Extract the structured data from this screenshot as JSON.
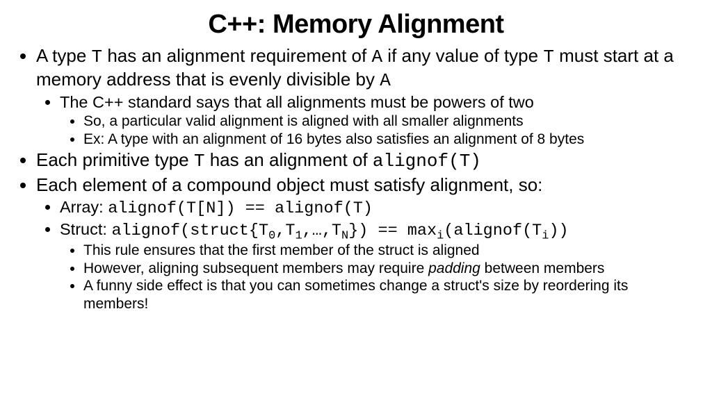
{
  "title": "C++: Memory Alignment",
  "b1": {
    "pre1": "A type ",
    "code1": "T",
    "mid1": " has an alignment requirement of ",
    "code2": "A",
    "mid2": " if any value of type ",
    "code3": "T",
    "mid3": " must start at a memory address that is evenly divisible by ",
    "code4": "A",
    "s1": "The C++ standard says that all alignments must be powers of two",
    "s1a": "So, a particular valid alignment is aligned with all smaller alignments",
    "s1b": "Ex: A type with an alignment of 16 bytes also satisfies an alignment of 8 bytes"
  },
  "b2": {
    "pre": "Each primitive type ",
    "code1": "T",
    "mid": " has an alignment of ",
    "code2": "alignof(T)"
  },
  "b3": {
    "text": "Each element of a compound object must satisfy alignment, so:",
    "arr_pre": "Array: ",
    "arr_code": "alignof(T[N]) == alignof(T)",
    "str_pre": "Struct: ",
    "str_c1": "alignof(struct{T",
    "str_s0": "0",
    "str_c2": ",T",
    "str_s1": "1",
    "str_c3": ",…,T",
    "str_sN": "N",
    "str_c4": "}) == max",
    "str_si": "i",
    "str_c5": "(alignof(T",
    "str_si2": "i",
    "str_c6": "))",
    "r1": "This rule ensures that the first member of the struct is aligned",
    "r2a": "However, aligning subsequent members may require ",
    "r2i": "padding",
    "r2b": " between members",
    "r3": "A funny side effect is that you can sometimes change a struct's size by reordering its members!"
  }
}
